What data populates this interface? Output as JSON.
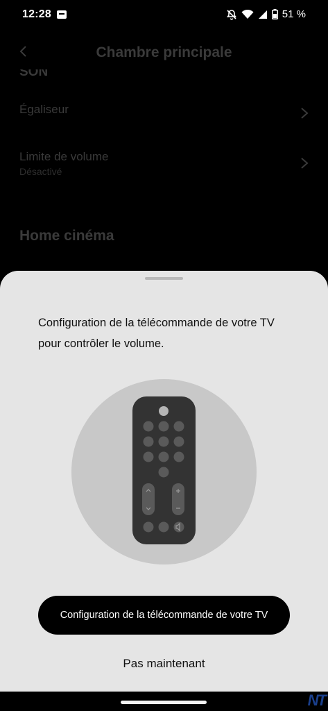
{
  "status_bar": {
    "time": "12:28",
    "battery": "51 %",
    "icons": [
      "notification-app-icon",
      "bell-off-icon",
      "wifi-icon",
      "signal-icon",
      "battery-icon"
    ]
  },
  "background_screen": {
    "title": "Chambre principale",
    "section_partial": "SON",
    "rows": [
      {
        "label": "Égaliseur",
        "sub": ""
      },
      {
        "label": "Limite de volume",
        "sub": "Désactivé"
      }
    ],
    "section_title": "Home cinéma"
  },
  "sheet": {
    "message": "Configuration de la télécommande de votre TV pour contrôler le volume.",
    "primary_button": "Configuration de la télécommande de votre TV",
    "secondary_button": "Pas maintenant",
    "illustration": "tv-remote-icon"
  },
  "watermark": "NT",
  "colors": {
    "sheet_bg": "#e5e5e5",
    "primary_button_bg": "#000000",
    "illustration_circle": "#c8c8c8",
    "remote_body": "#333333"
  }
}
